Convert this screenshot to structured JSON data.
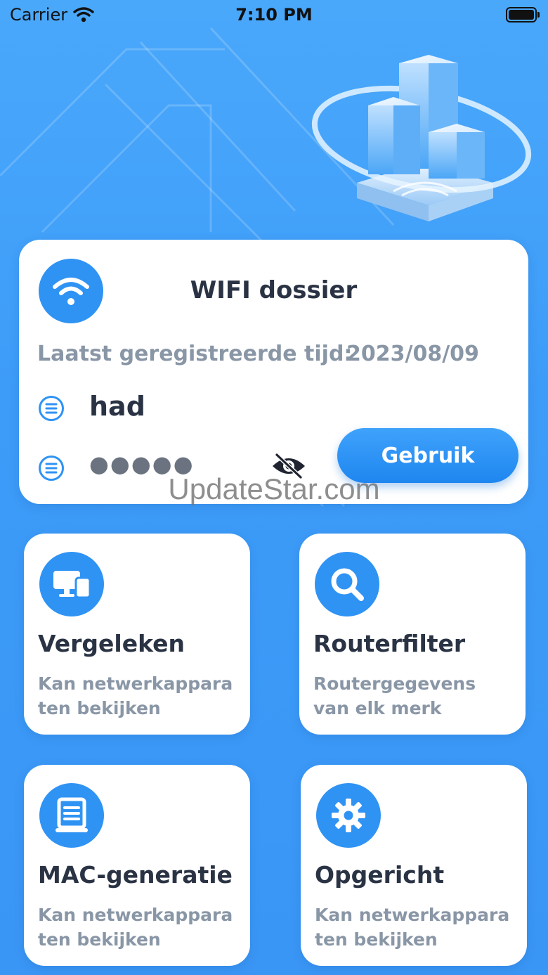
{
  "status_bar": {
    "carrier": "Carrier",
    "time": "7:10 PM"
  },
  "wifi_card": {
    "icon": "wifi-icon",
    "title": "WIFI dossier",
    "registered_label": "Laatst geregistreerde tijd:",
    "registered_date": "2023/08/09",
    "ssid": "had",
    "password_masked": "●●●●●",
    "use_button": "Gebruik"
  },
  "tiles": [
    {
      "icon": "devices-icon",
      "title": "Vergeleken",
      "desc_line1": "Kan netwerkappara",
      "desc_line2": "ten bekijken"
    },
    {
      "icon": "search-icon",
      "title": "Routerfilter",
      "desc_line1": "Routergegevens",
      "desc_line2": "van elk merk"
    },
    {
      "icon": "document-icon",
      "title": "MAC-generatie",
      "desc_line1": "Kan netwerkappara",
      "desc_line2": "ten bekijken"
    },
    {
      "icon": "gear-icon",
      "title": "Opgericht",
      "desc_line1": "Kan netwerkappara",
      "desc_line2": "ten bekijken"
    }
  ],
  "watermark": "UpdateStar.com",
  "colors": {
    "accent": "#2f93f4",
    "background": "#3d9cf8",
    "title_text": "#2a3344",
    "muted_text": "#8996a6"
  }
}
